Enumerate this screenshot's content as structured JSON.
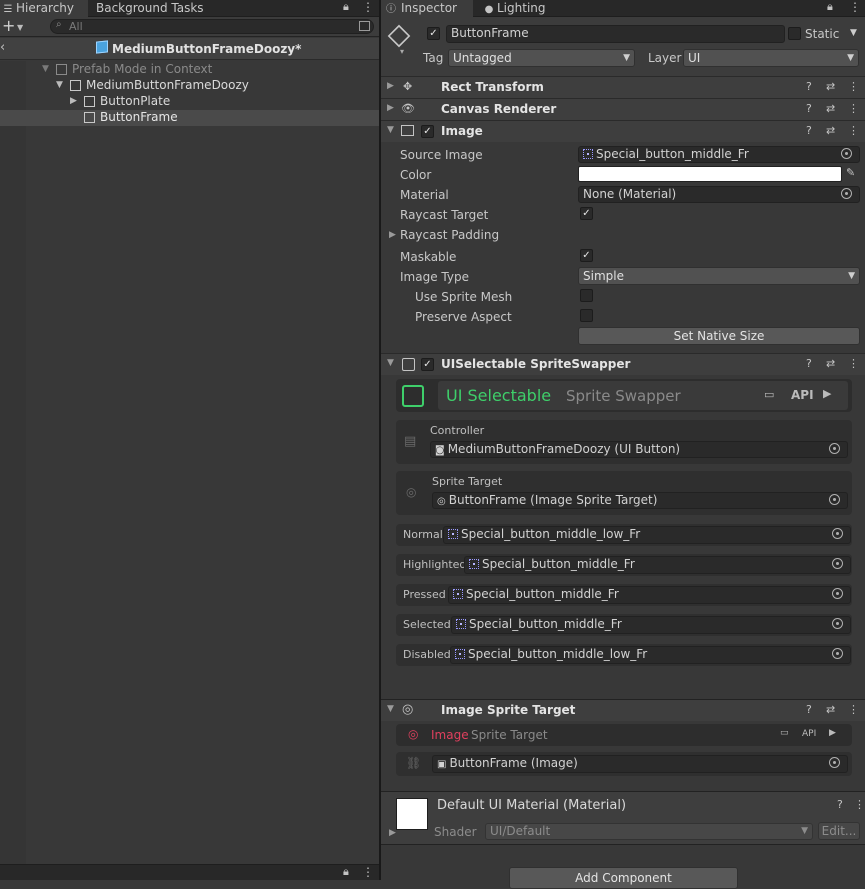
{
  "hierarchy": {
    "tabs": [
      "Hierarchy",
      "Background Tasks"
    ],
    "search_placeholder": "All",
    "prefab_title": "MediumButtonFrameDoozy*",
    "items": [
      {
        "label": "Prefab Mode in Context"
      },
      {
        "label": "MediumButtonFrameDoozy"
      },
      {
        "label": "ButtonPlate"
      },
      {
        "label": "ButtonFrame"
      }
    ]
  },
  "inspector": {
    "tabs": [
      "Inspector",
      "Lighting"
    ],
    "object_name": "ButtonFrame",
    "static_label": "Static",
    "tag_label": "Tag",
    "tag_value": "Untagged",
    "layer_label": "Layer",
    "layer_value": "UI",
    "components": {
      "rect_transform": "Rect Transform",
      "canvas_renderer": "Canvas Renderer",
      "image": "Image",
      "ui_selectable": "UISelectable SpriteSwapper",
      "image_sprite_target": "Image Sprite Target"
    },
    "image": {
      "source_image_label": "Source Image",
      "source_image_value": "Special_button_middle_Fr",
      "color_label": "Color",
      "color_value": "#ffffff",
      "material_label": "Material",
      "material_value": "None (Material)",
      "raycast_target_label": "Raycast Target",
      "raycast_padding_label": "Raycast Padding",
      "maskable_label": "Maskable",
      "image_type_label": "Image Type",
      "image_type_value": "Simple",
      "use_sprite_mesh_label": "Use Sprite Mesh",
      "preserve_aspect_label": "Preserve Aspect",
      "set_native_size_label": "Set Native Size"
    },
    "swapper": {
      "banner_title": "UI Selectable",
      "banner_subtitle": "Sprite Swapper",
      "api_label": "API",
      "controller_label": "Controller",
      "controller_value": "MediumButtonFrameDoozy (UI Button)",
      "sprite_target_label": "Sprite Target",
      "sprite_target_value": "ButtonFrame (Image Sprite Target)",
      "states": [
        {
          "label": "Normal",
          "value": "Special_button_middle_low_Fr"
        },
        {
          "label": "Highlighted",
          "value": "Special_button_middle_Fr"
        },
        {
          "label": "Pressed",
          "value": "Special_button_middle_Fr"
        },
        {
          "label": "Selected",
          "value": "Special_button_middle_Fr"
        },
        {
          "label": "Disabled",
          "value": "Special_button_middle_low_Fr"
        }
      ]
    },
    "sprite_target": {
      "banner_title": "Image",
      "banner_subtitle": "Sprite Target",
      "api_label": "API",
      "image_value": "ButtonFrame (Image)"
    },
    "material": {
      "name": "Default UI Material (Material)",
      "shader_label": "Shader",
      "shader_value": "UI/Default",
      "edit_label": "Edit..."
    },
    "add_component_label": "Add Component"
  },
  "colors": {
    "accent_green": "#3ecf6a",
    "accent_red": "#e0405e",
    "panel_bg": "#383838"
  }
}
